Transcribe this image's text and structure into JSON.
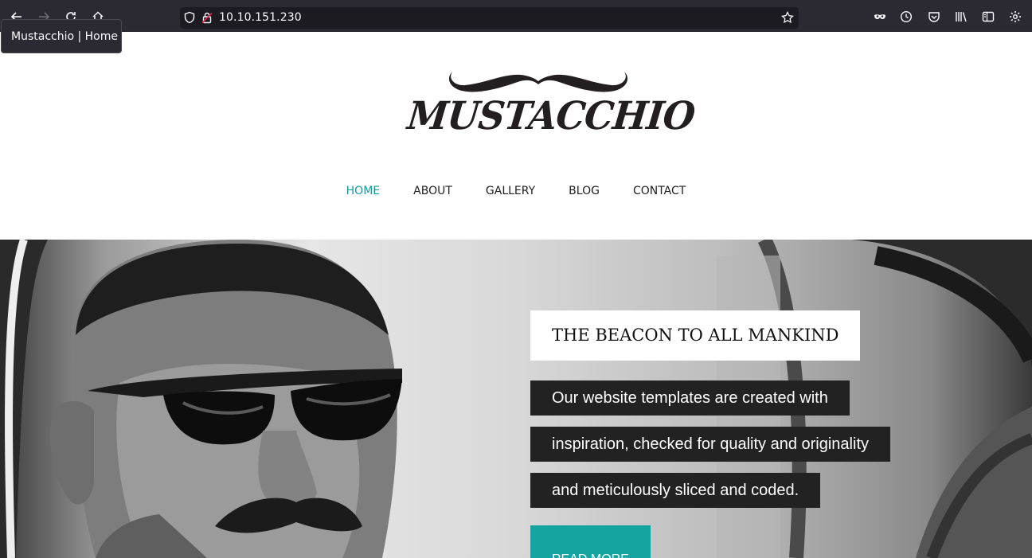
{
  "browser": {
    "url": "10.10.151.230",
    "tooltip": "Mustacchio | Home"
  },
  "site": {
    "logo_text": "MUSTACCHIO",
    "nav": [
      {
        "label": "HOME",
        "active": true
      },
      {
        "label": "ABOUT",
        "active": false
      },
      {
        "label": "GALLERY",
        "active": false
      },
      {
        "label": "BLOG",
        "active": false
      },
      {
        "label": "CONTACT",
        "active": false
      }
    ]
  },
  "hero": {
    "title": "THE BEACON TO ALL MANKIND",
    "lines": [
      "Our website templates are created with",
      "inspiration, checked for quality and originality",
      "and meticulously sliced and coded."
    ],
    "button": "READ MORE"
  },
  "colors": {
    "accent": "#14a39e",
    "nav_active": "#139e9a",
    "browser_bg": "#2b2a33",
    "caption_bg": "#222222"
  }
}
